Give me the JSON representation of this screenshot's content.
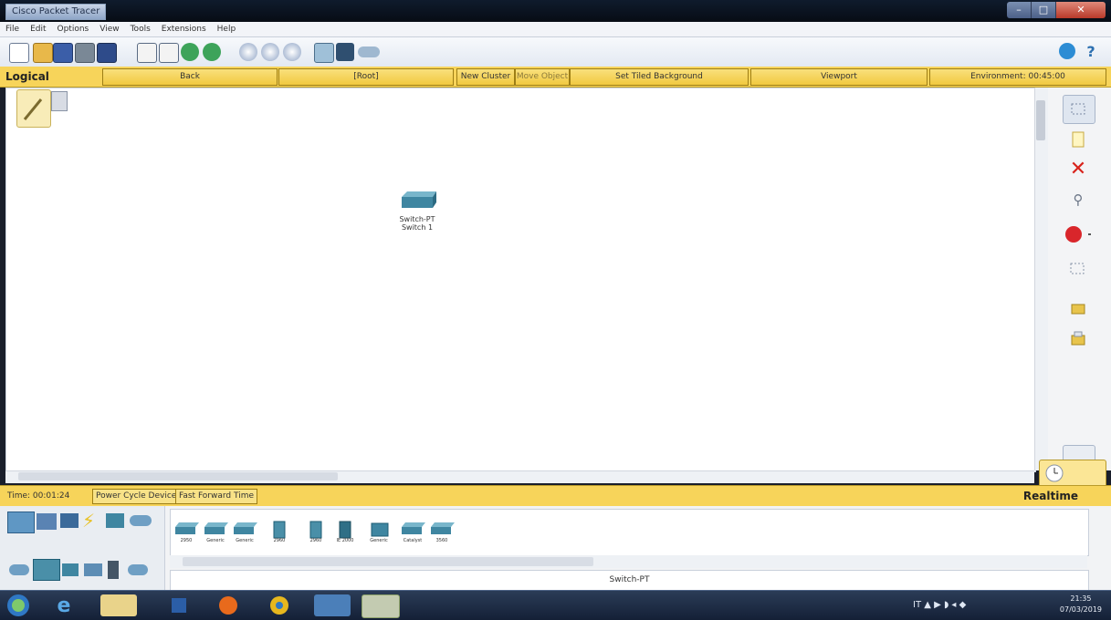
{
  "window": {
    "title": "Cisco Packet Tracer"
  },
  "menu": [
    "File",
    "Edit",
    "Options",
    "View",
    "Tools",
    "Extensions",
    "Help"
  ],
  "topbar": {
    "mode": "Logical",
    "back": "Back",
    "root": "[Root]",
    "new_cluster": "New Cluster",
    "move_object": "Move Object",
    "set_tiled_background": "Set Tiled Background",
    "viewport": "Viewport",
    "environment": "Environment: 00:45:00"
  },
  "canvas": {
    "node": {
      "type": "Switch-PT",
      "name": "Switch 1"
    }
  },
  "status": {
    "time": "Time: 00:01:24",
    "power_cycle": "Power Cycle Devices",
    "fast_forward": "Fast Forward Time",
    "mode": "Realtime"
  },
  "devices": {
    "models": [
      "2950",
      "Generic",
      "Generic",
      "2960",
      "2960",
      "IE 2000",
      "Generic",
      "Catalyst",
      "3560"
    ],
    "selected_name": "Switch-PT"
  },
  "clock": {
    "time": "21:35",
    "date": "07/03/2019"
  },
  "colors": {
    "bar": "#f7d45a",
    "switch": "#4a8fa8"
  },
  "icons": [
    "new-icon",
    "open-icon",
    "save-icon",
    "print-icon",
    "activity-wizard-icon",
    "copy-icon",
    "paste-icon",
    "undo-icon",
    "redo-icon",
    "zoom-in-icon",
    "zoom-reset-icon",
    "zoom-out-icon",
    "palette-icon",
    "custom-device-icon",
    "cloud-icon",
    "info-icon",
    "help-icon",
    "select-icon",
    "note-icon",
    "delete-icon",
    "inspect-icon",
    "draw-shape-icon",
    "resize-icon",
    "add-simple-pdu-icon",
    "add-complex-pdu-icon"
  ]
}
